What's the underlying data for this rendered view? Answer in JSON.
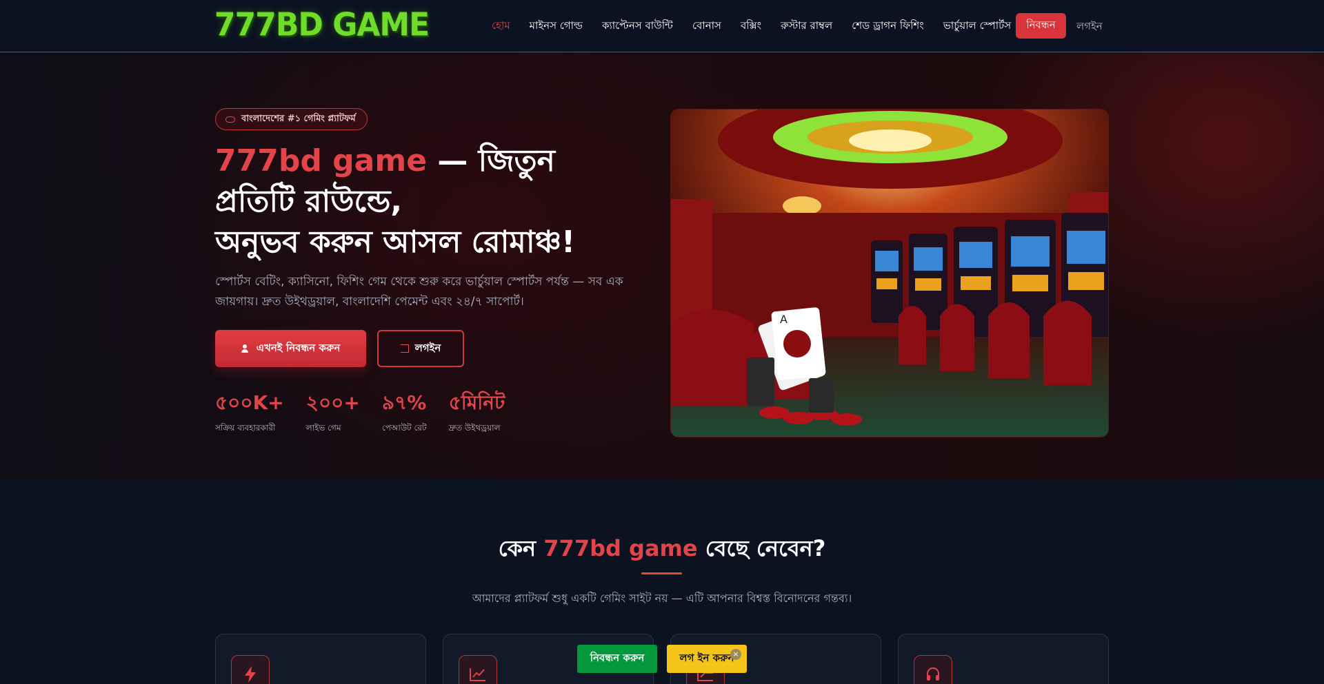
{
  "brand": {
    "logo_text": "777BD GAME"
  },
  "nav": {
    "links": [
      {
        "label": "হোম",
        "active": true
      },
      {
        "label": "মাইনস গোল্ড"
      },
      {
        "label": "ক্যাপ্টেনস বাউন্টি"
      },
      {
        "label": "বোনাস"
      },
      {
        "label": "বক্সিং"
      },
      {
        "label": "রুস্টার রাম্বল"
      },
      {
        "label": "শেড ড্রাগন ফিশিং"
      },
      {
        "label": "ভার্চুয়াল স্পোর্টস"
      }
    ],
    "register_label": "নিবন্ধন",
    "login_label": "লগইন"
  },
  "hero": {
    "badge": "বাংলাদেশের #১ গেমিং প্ল্যাটফর্ম",
    "headline_accent": "777bd game",
    "headline_line1_rest": " — জিতুন প্রতিটি রাউন্ডে,",
    "headline_line2": "অনুভব করুন আসল রোমাঞ্চ!",
    "subtitle": "স্পোর্টস বেটিং, ক্যাসিনো, ফিশিং গেম থেকে শুরু করে ভার্চুয়াল স্পোর্টস পর্যন্ত — সব এক জায়গায়। দ্রুত উইথড্রয়াল, বাংলাদেশি পেমেন্ট এবং ২৪/৭ সাপোর্ট।",
    "cta_register": "এখনই নিবন্ধন করুন",
    "cta_login": "লগইন",
    "stats": [
      {
        "value": "৫০০K+",
        "label": "সক্রিয় ব্যবহারকারী"
      },
      {
        "value": "২০০+",
        "label": "লাইভ গেম"
      },
      {
        "value": "৯৭%",
        "label": "পেআউট রেট"
      },
      {
        "value": "৫মিনিট",
        "label": "দ্রুত উইথড্রয়াল"
      }
    ]
  },
  "why": {
    "title_prefix": "কেন ",
    "title_accent": "777bd game",
    "title_suffix": " বেছে নেবেন?",
    "subtitle": "আমাদের প্ল্যাটফর্ম শুধু একটি গেমিং সাইট নয় — এটি আপনার বিশ্বস্ত বিনোদনের গন্তব্য।",
    "cards": [
      {
        "icon": "lightning-icon"
      },
      {
        "icon": "chart-up-icon"
      },
      {
        "icon": "chart-icon"
      },
      {
        "icon": "headset-icon"
      }
    ]
  },
  "floating": {
    "register_label": "নিবন্ধন করুন",
    "login_label": "লগ ইন করুন",
    "close_glyph": "×"
  },
  "colors": {
    "accent": "#e2444a",
    "background": "#0d1220",
    "register_green": "#04973c",
    "login_yellow": "#f4c518"
  }
}
